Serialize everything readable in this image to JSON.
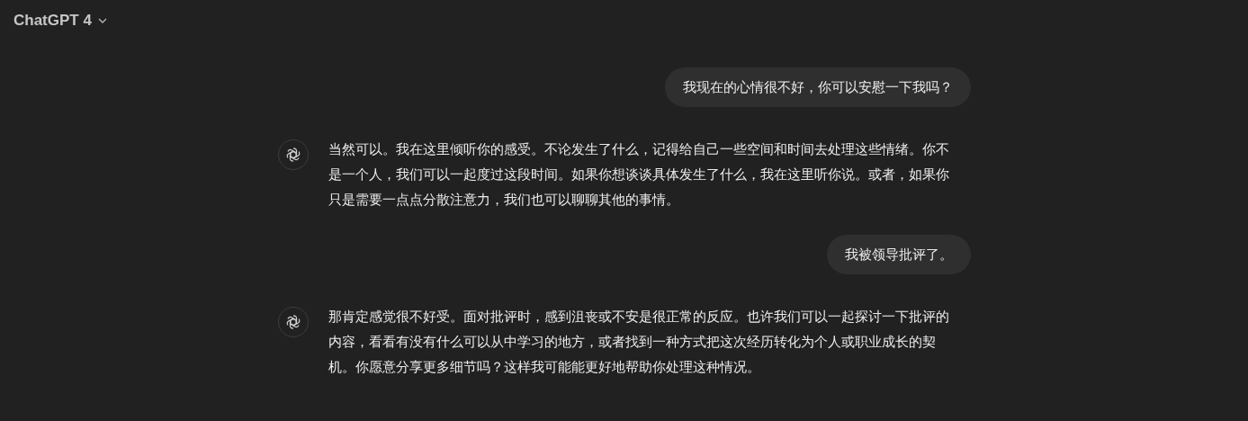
{
  "header": {
    "model": "ChatGPT 4"
  },
  "messages": [
    {
      "kind": "user",
      "text": "我现在的心情很不好，你可以安慰一下我吗？"
    },
    {
      "kind": "assistant",
      "text": "当然可以。我在这里倾听你的感受。不论发生了什么，记得给自己一些空间和时间去处理这些情绪。你不是一个人，我们可以一起度过这段时间。如果你想谈谈具体发生了什么，我在这里听你说。或者，如果你只是需要一点点分散注意力，我们也可以聊聊其他的事情。"
    },
    {
      "kind": "user",
      "text": "我被领导批评了。"
    },
    {
      "kind": "assistant",
      "text": "那肯定感觉很不好受。面对批评时，感到沮丧或不安是很正常的反应。也许我们可以一起探讨一下批评的内容，看看有没有什么可以从中学习的地方，或者找到一种方式把这次经历转化为个人或职业成长的契机。你愿意分享更多细节吗？这样我可能能更好地帮助你处理这种情况。"
    }
  ]
}
